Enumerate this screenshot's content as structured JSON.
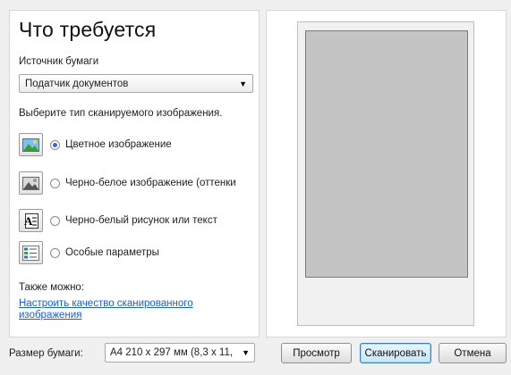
{
  "left": {
    "title": "Что требуется",
    "paper_source_label": "Источник бумаги",
    "paper_source_value": "Податчик документов",
    "image_type_prompt": "Выберите тип сканируемого изображения.",
    "options": [
      {
        "label": "Цветное изображение",
        "checked": true,
        "icon": "color-photo-icon"
      },
      {
        "label": "Черно-белое изображение (оттенки",
        "checked": false,
        "icon": "grayscale-photo-icon"
      },
      {
        "label": "Черно-белый рисунок или текст",
        "checked": false,
        "icon": "text-document-icon"
      },
      {
        "label": "Особые параметры",
        "checked": false,
        "icon": "custom-settings-icon"
      }
    ],
    "also_label": "Также можно:",
    "adjust_link": "Настроить качество сканированного изображения"
  },
  "bottom": {
    "paper_size_label": "Размер бумаги:",
    "paper_size_value": "A4 210 x 297 мм (8,3 x 11,",
    "preview_button": "Просмотр",
    "scan_button": "Сканировать",
    "cancel_button": "Отмена"
  },
  "colors": {
    "accent": "#2d6ad6",
    "link": "#1a5fd6",
    "preview_gray": "#c4c4c4"
  }
}
